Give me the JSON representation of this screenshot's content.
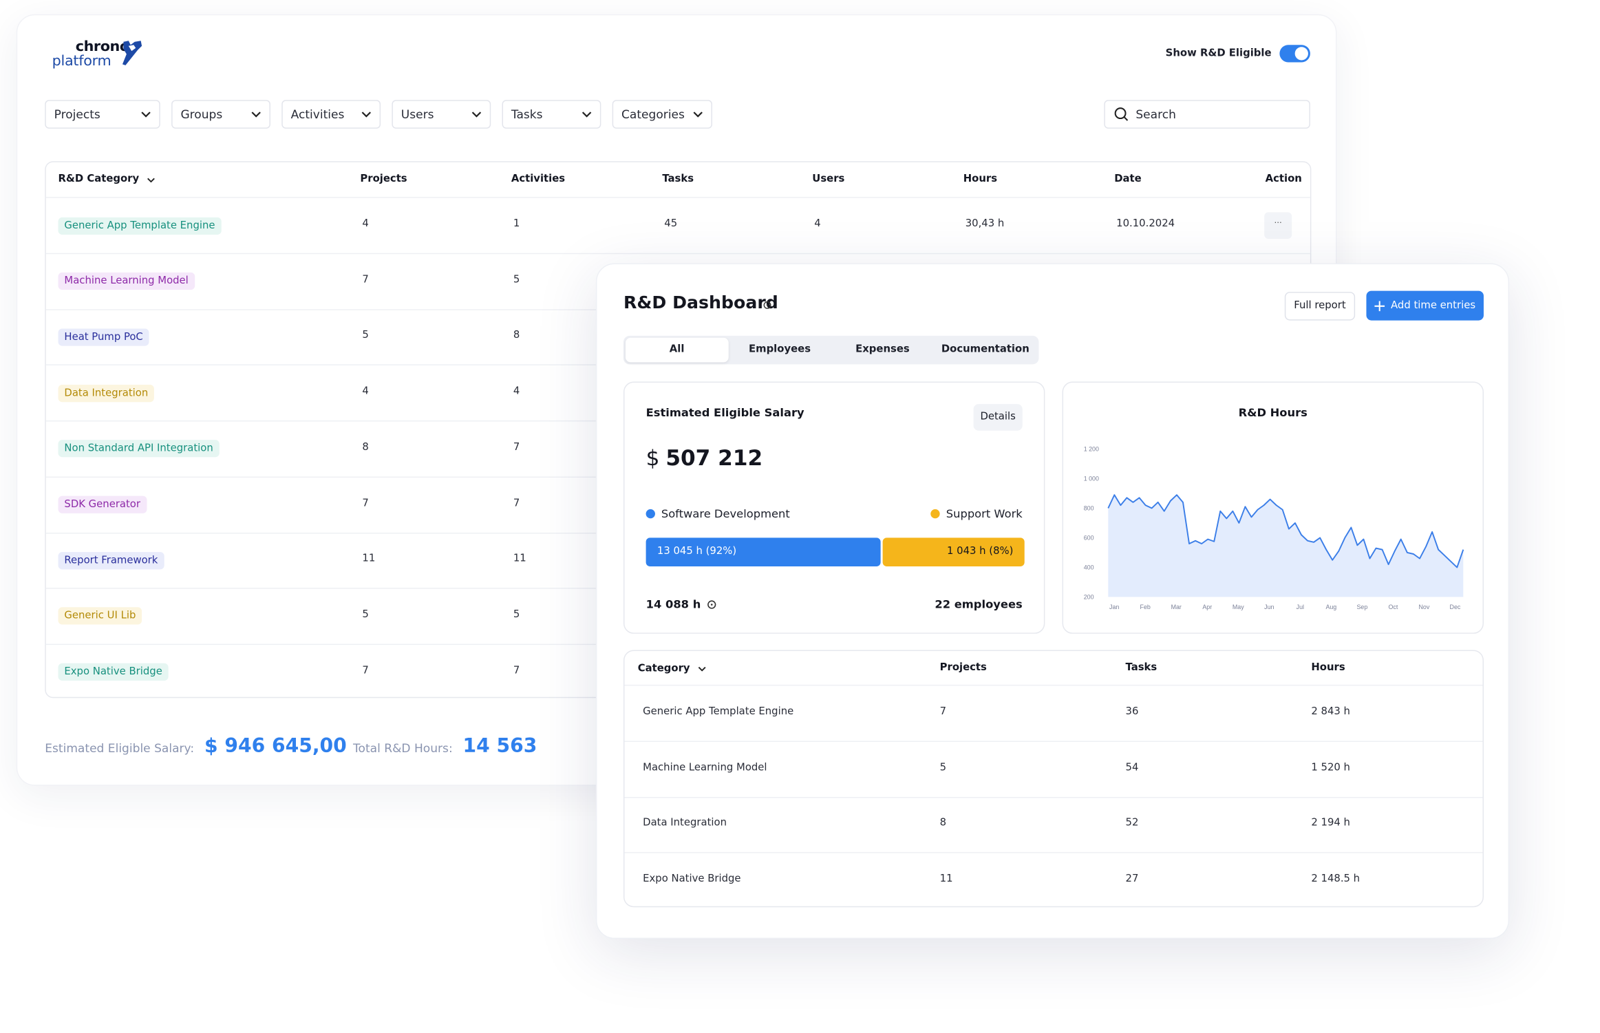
{
  "brand": {
    "line1": "chrono",
    "line2": "platform"
  },
  "toggle": {
    "label": "Show R&D Eligible",
    "on": true
  },
  "filters": [
    "Projects",
    "Groups",
    "Activities",
    "Users",
    "Tasks",
    "Categories"
  ],
  "search": {
    "placeholder": "Search"
  },
  "main_table": {
    "headers": {
      "category": "R&D Category",
      "projects": "Projects",
      "activities": "Activities",
      "tasks": "Tasks",
      "users": "Users",
      "hours": "Hours",
      "date": "Date",
      "action": "Action"
    },
    "rows": [
      {
        "category": "Generic App Template Engine",
        "color": "teal",
        "projects": "4",
        "activities": "1",
        "tasks": "45",
        "users": "4",
        "hours": "30,43 h",
        "date": "10.10.2024",
        "action": "···"
      },
      {
        "category": "Machine Learning Model",
        "color": "purple",
        "projects": "7",
        "activities": "5"
      },
      {
        "category": "Heat Pump PoC",
        "color": "indigo",
        "projects": "5",
        "activities": "8"
      },
      {
        "category": "Data Integration",
        "color": "amber",
        "projects": "4",
        "activities": "4"
      },
      {
        "category": "Non Standard API Integration",
        "color": "teal",
        "projects": "8",
        "activities": "7"
      },
      {
        "category": "SDK Generator",
        "color": "purple",
        "projects": "7",
        "activities": "7"
      },
      {
        "category": "Report Framework",
        "color": "indigo",
        "projects": "11",
        "activities": "11"
      },
      {
        "category": "Generic UI Lib",
        "color": "amber",
        "projects": "5",
        "activities": "5"
      },
      {
        "category": "Expo Native Bridge",
        "color": "teal",
        "projects": "7",
        "activities": "7"
      }
    ]
  },
  "footer": {
    "salary_label": "Estimated Eligible Salary:",
    "salary_value": "$ 946 645,00",
    "hours_label": "Total R&D Hours:",
    "hours_value": "14 563"
  },
  "dashboard": {
    "title": "R&D Dashboard",
    "full_report": "Full report",
    "add_time": "Add time entries",
    "tabs": [
      "All",
      "Employees",
      "Expenses",
      "Documentation"
    ],
    "active_tab": "All",
    "salary": {
      "heading": "Estimated Eligible Salary",
      "details": "Details",
      "currency": "$",
      "amount": "507 212",
      "legend": [
        {
          "label": "Software Development",
          "color": "#2f80ed"
        },
        {
          "label": "Support Work",
          "color": "#f5b51b"
        }
      ],
      "bar": [
        {
          "label": "13 045 h (92%)",
          "share": 0.92
        },
        {
          "label": "1 043 h (8%)",
          "share": 0.08
        }
      ],
      "total_hours": "14 088 h",
      "employees": "22 employees"
    },
    "categories": {
      "headers": {
        "category": "Category",
        "projects": "Projects",
        "tasks": "Tasks",
        "hours": "Hours"
      },
      "rows": [
        {
          "category": "Generic App Template Engine",
          "projects": "7",
          "tasks": "36",
          "hours": "2 843 h"
        },
        {
          "category": "Machine Learning Model",
          "projects": "5",
          "tasks": "54",
          "hours": "1 520 h"
        },
        {
          "category": "Data Integration",
          "projects": "8",
          "tasks": "52",
          "hours": "2 194 h"
        },
        {
          "category": "Expo Native Bridge",
          "projects": "11",
          "tasks": "27",
          "hours": "2 148.5 h"
        }
      ]
    }
  },
  "chart_data": {
    "type": "area",
    "title": "R&D Hours",
    "y_ticks": [
      "1 200",
      "1 000",
      "800",
      "600",
      "400",
      "200"
    ],
    "ylim": [
      200,
      1200
    ],
    "x_ticks": [
      "Jan",
      "Feb",
      "Mar",
      "Apr",
      "May",
      "Jun",
      "Jul",
      "Aug",
      "Sep",
      "Oct",
      "Nov",
      "Dec"
    ],
    "color": "#3b7ee8",
    "fill": "#e3ecfd",
    "values": [
      800,
      890,
      820,
      870,
      840,
      870,
      820,
      800,
      840,
      780,
      850,
      890,
      840,
      560,
      580,
      560,
      590,
      575,
      780,
      730,
      780,
      700,
      810,
      740,
      790,
      820,
      860,
      820,
      790,
      660,
      700,
      620,
      580,
      570,
      600,
      520,
      450,
      510,
      600,
      670,
      550,
      590,
      460,
      530,
      520,
      420,
      510,
      590,
      500,
      490,
      460,
      540,
      640,
      520,
      480,
      440,
      400,
      520
    ]
  }
}
